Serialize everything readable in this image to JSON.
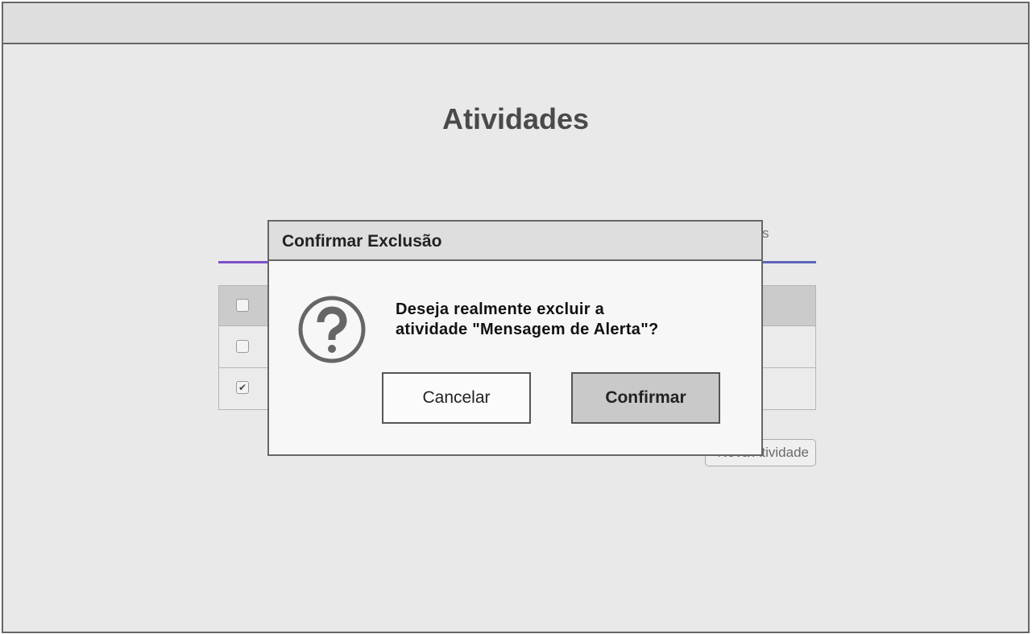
{
  "page": {
    "title": "Atividades",
    "tab_partial_text": "s"
  },
  "table": {
    "rows": [
      {
        "checked": false,
        "kind": "header"
      },
      {
        "checked": false,
        "kind": "row"
      },
      {
        "checked": true,
        "kind": "row",
        "check_glyph": "✔"
      }
    ]
  },
  "new_button": {
    "label": "Nova Atividade"
  },
  "dialog": {
    "title": "Confirmar Exclusão",
    "icon": "question-circle-icon",
    "message_line1": "Deseja realmente excluir a",
    "message_line2": "atividade \"Mensagem de Alerta\"?",
    "cancel_label": "Cancelar",
    "confirm_label": "Confirmar"
  },
  "colors": {
    "tab_accent_start": "#7f4fc9",
    "tab_accent_end": "#5c66b8",
    "dialog_border": "#666666"
  }
}
